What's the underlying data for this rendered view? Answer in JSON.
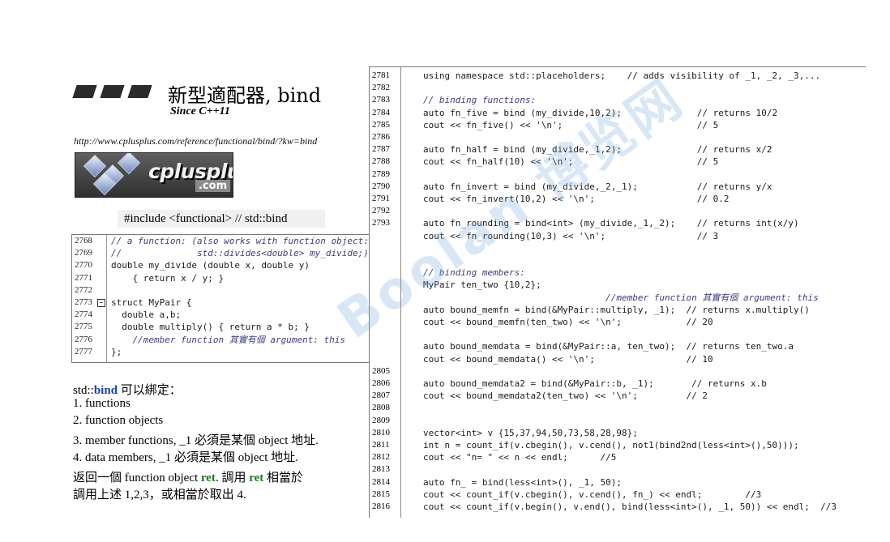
{
  "title": "新型適配器, bind",
  "since": "Since C++11",
  "url": "http://www.cplusplus.com/reference/functional/bind/?kw=bind",
  "logo": {
    "name": "cplusplus",
    "domain": ".com"
  },
  "include_line": "#include <functional>   // std::bind",
  "left_code": [
    {
      "n": "2768",
      "t": "// a function: (also works with function object:"
    },
    {
      "n": "2769",
      "t": "//              std::divides<double> my_divide;)"
    },
    {
      "n": "2770",
      "t": "double my_divide (double x, double y)"
    },
    {
      "n": "2771",
      "t": "    { return x / y; }"
    },
    {
      "n": "2772",
      "t": ""
    },
    {
      "n": "2773",
      "t": "struct MyPair {"
    },
    {
      "n": "2774",
      "t": "  double a,b;"
    },
    {
      "n": "2775",
      "t": "  double multiply() { return a * b; }"
    },
    {
      "n": "2776",
      "t": "    //member function 其實有個 argument: this"
    },
    {
      "n": "2777",
      "t": "};"
    }
  ],
  "right_code": [
    {
      "n": "2781",
      "t": "using namespace std::placeholders;    // adds visibility of _1, _2, _3,..."
    },
    {
      "n": "2782",
      "t": ""
    },
    {
      "n": "2783",
      "t": "// binding functions:"
    },
    {
      "n": "2784",
      "t": "auto fn_five = bind (my_divide,10,2);              // returns 10/2"
    },
    {
      "n": "2785",
      "t": "cout << fn_five() << '\\n';                         // 5"
    },
    {
      "n": "2786",
      "t": ""
    },
    {
      "n": "2787",
      "t": "auto fn_half = bind (my_divide,_1,2);              // returns x/2"
    },
    {
      "n": "2788",
      "t": "cout << fn_half(10) << '\\n';                       // 5"
    },
    {
      "n": "2789",
      "t": ""
    },
    {
      "n": "2790",
      "t": "auto fn_invert = bind (my_divide,_2,_1);           // returns y/x"
    },
    {
      "n": "2791",
      "t": "cout << fn_invert(10,2) << '\\n';                   // 0.2"
    },
    {
      "n": "2792",
      "t": ""
    },
    {
      "n": "2793",
      "t": "auto fn_rounding = bind<int> (my_divide,_1,_2);    // returns int(x/y)"
    },
    {
      "n": "",
      "t": "cout << fn_rounding(10,3) << '\\n';                 // 3"
    },
    {
      "n": "",
      "t": ""
    },
    {
      "n": "",
      "t": ""
    },
    {
      "n": "",
      "t": "// binding members:"
    },
    {
      "n": "",
      "t": "MyPair ten_two {10,2};"
    },
    {
      "n": "",
      "t": "                                  //member function 其實有個 argument: this"
    },
    {
      "n": "",
      "t": "auto bound_memfn = bind(&MyPair::multiply, _1);  // returns x.multiply()"
    },
    {
      "n": "",
      "t": "cout << bound_memfn(ten_two) << '\\n';            // 20"
    },
    {
      "n": "",
      "t": ""
    },
    {
      "n": "",
      "t": "auto bound_memdata = bind(&MyPair::a, ten_two);  // returns ten_two.a"
    },
    {
      "n": "",
      "t": "cout << bound_memdata() << '\\n';                 // 10"
    },
    {
      "n": "2805",
      "t": ""
    },
    {
      "n": "2806",
      "t": "auto bound_memdata2 = bind(&MyPair::b, _1);       // returns x.b"
    },
    {
      "n": "2807",
      "t": "cout << bound_memdata2(ten_two) << '\\n';         // 2"
    },
    {
      "n": "2808",
      "t": ""
    },
    {
      "n": "2809",
      "t": ""
    },
    {
      "n": "2810",
      "t": "vector<int> v {15,37,94,50,73,58,28,98};"
    },
    {
      "n": "2811",
      "t": "int n = count_if(v.cbegin(), v.cend(), not1(bind2nd(less<int>(),50)));"
    },
    {
      "n": "2812",
      "t": "cout << \"n= \" << n << endl;      //5"
    },
    {
      "n": "2813",
      "t": ""
    },
    {
      "n": "2814",
      "t": "auto fn_ = bind(less<int>(), _1, 50);"
    },
    {
      "n": "2815",
      "t": "cout << count_if(v.cbegin(), v.cend(), fn_) << endl;        //3"
    },
    {
      "n": "2816",
      "t": "cout << count_if(v.begin(), v.end(), bind(less<int>(), _1, 50)) << endl;  //3"
    }
  ],
  "desc": {
    "line0_pre": "std::",
    "line0_kw": "bind",
    "line0_post": " 可以綁定：",
    "items": [
      "1. functions",
      "2. function objects",
      "3. member functions, _1 必須是某個 object 地址.",
      "4. data members, _1 必須是某個 object 地址."
    ],
    "ret_a": "返回一個 function object ",
    "ret_kw1": "ret",
    "ret_b": ". 調用 ",
    "ret_kw2": "ret",
    "ret_c": " 相當於",
    "ret_line2": "調用上述 1,2,3，或相當於取出 4."
  },
  "watermark": "Boolan 博览网"
}
